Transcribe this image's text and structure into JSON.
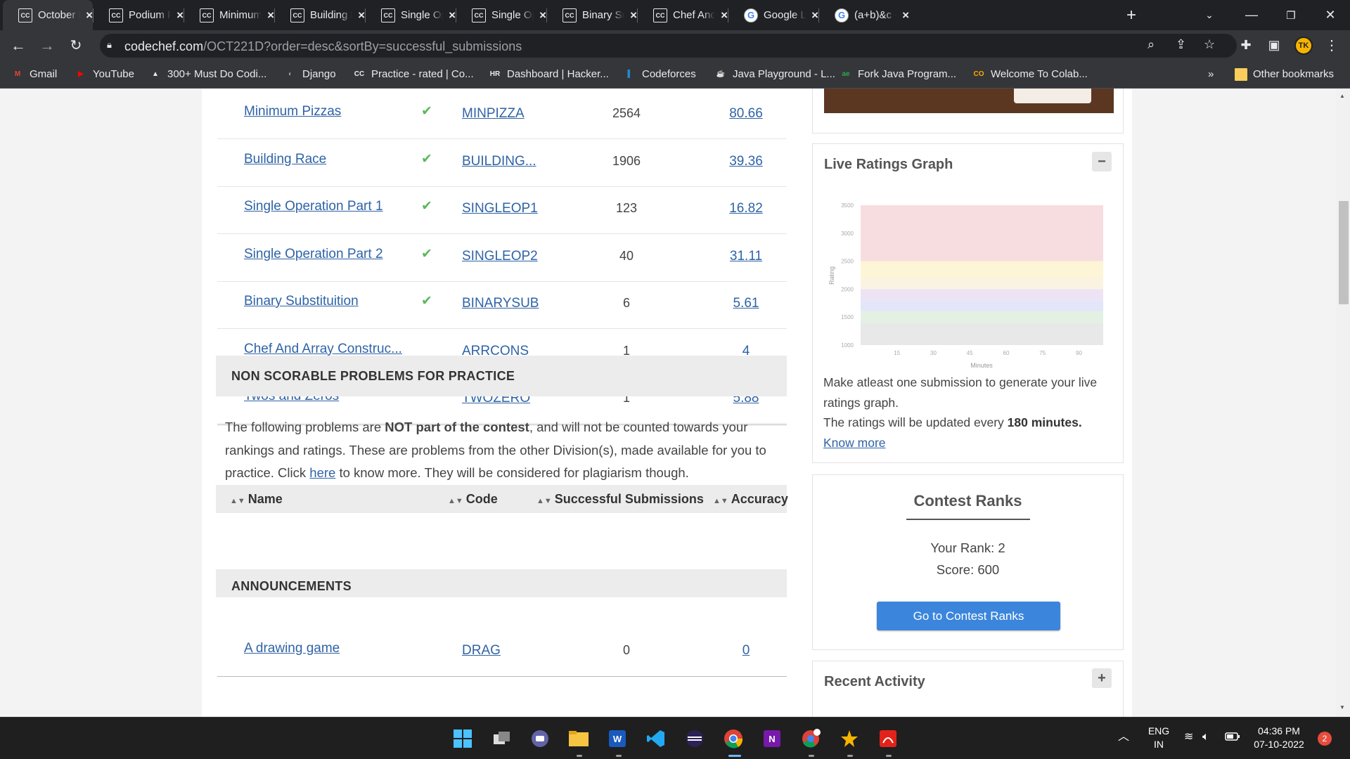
{
  "browser": {
    "tabs": [
      {
        "icon": "CC",
        "title": "October Long"
      },
      {
        "icon": "CC",
        "title": "Podium Finish"
      },
      {
        "icon": "CC",
        "title": "Minimum Pizzas"
      },
      {
        "icon": "CC",
        "title": "Building Race"
      },
      {
        "icon": "CC",
        "title": "Single Operation"
      },
      {
        "icon": "CC",
        "title": "Single Operation"
      },
      {
        "icon": "CC",
        "title": "Binary Substituition"
      },
      {
        "icon": "CC",
        "title": "Chef And Array"
      },
      {
        "icon": "G",
        "title": "Google Lens"
      },
      {
        "icon": "G",
        "title": "(a+b)&c - Google"
      }
    ],
    "new_tab_label": "+",
    "url_host": "codechef.com",
    "url_path": "/OCT221D?order=desc&sortBy=successful_submissions",
    "profile_initials": "TK",
    "bookmarks": [
      {
        "icon": "M",
        "label": "Gmail",
        "color": "#ea4335"
      },
      {
        "icon": "▶",
        "label": "YouTube",
        "color": "#ff0000"
      },
      {
        "icon": "▲",
        "label": "300+ Must Do Codi...",
        "color": "#e8eaed"
      },
      {
        "icon": "◐",
        "label": "Django",
        "color": "#9aa0a6"
      },
      {
        "icon": "CC",
        "label": "Practice - rated | Co...",
        "color": "#e8eaed"
      },
      {
        "icon": "HR",
        "label": "Dashboard | Hacker...",
        "color": "#e8eaed"
      },
      {
        "icon": "▌",
        "label": "Codeforces",
        "color": "#1f8acb"
      },
      {
        "icon": "☕",
        "label": "Java Playground - L...",
        "color": "#f89820"
      },
      {
        "icon": "ae",
        "label": "Fork Java Program...",
        "color": "#2aa84a"
      },
      {
        "icon": "CO",
        "label": "Welcome To Colab...",
        "color": "#f9ab00"
      }
    ],
    "more_bookmarks": "»",
    "other_bookmarks": "Other bookmarks"
  },
  "problems": [
    {
      "name": "Minimum Pizzas",
      "solved": true,
      "code": "MINPIZZA",
      "successful_submissions": "2564",
      "accuracy": "80.66"
    },
    {
      "name": "Building Race",
      "solved": true,
      "code": "BUILDING...",
      "successful_submissions": "1906",
      "accuracy": "39.36"
    },
    {
      "name": "Single Operation Part 1",
      "solved": true,
      "code": "SINGLEOP1",
      "successful_submissions": "123",
      "accuracy": "16.82"
    },
    {
      "name": "Single Operation Part 2",
      "solved": true,
      "code": "SINGLEOP2",
      "successful_submissions": "40",
      "accuracy": "31.11"
    },
    {
      "name": "Binary Substituition",
      "solved": true,
      "code": "BINARYSUB",
      "successful_submissions": "6",
      "accuracy": "5.61"
    },
    {
      "name": "Chef And Array Construc...",
      "solved": false,
      "code": "ARRCONS",
      "successful_submissions": "1",
      "accuracy": "4"
    },
    {
      "name": "Twos and Zeros",
      "solved": false,
      "code": "TWOZERO",
      "successful_submissions": "1",
      "accuracy": "5.88"
    }
  ],
  "non_scorable": {
    "title": "NON SCORABLE PROBLEMS FOR PRACTICE",
    "para_1": "The following problems are ",
    "para_bold": "NOT part of the contest",
    "para_2": ", and will not be counted towards your rankings and ratings. These are problems from the other Division(s), made available for you to practice. Click ",
    "para_link": "here",
    "para_3": " to know more. They will be considered for plagiarism though.",
    "headers": {
      "name": "Name",
      "code": "Code",
      "subs": "Successful Submissions",
      "acc": "Accuracy"
    },
    "rows": [
      {
        "name": "A drawing game",
        "code": "DRAG",
        "successful_submissions": "0",
        "accuracy": "0"
      }
    ]
  },
  "announcements_title": "ANNOUNCEMENTS",
  "live_graph": {
    "title": "Live Ratings Graph",
    "toggle": "−",
    "y_label": "Rating",
    "x_label": "Minutes",
    "msg": "Make atleast one submission to generate your live ratings graph.",
    "update_text": "The ratings will be updated every ",
    "update_bold": "180 minutes.",
    "know_more": "Know more"
  },
  "chart_data": {
    "type": "area",
    "title": "",
    "xlabel": "Minutes",
    "ylabel": "Rating",
    "x_ticks": [
      15,
      30,
      45,
      60,
      75,
      90
    ],
    "y_ticks": [
      1000,
      1500,
      2000,
      2500,
      3000,
      3500
    ],
    "ylim": [
      1000,
      3500
    ],
    "xlim": [
      0,
      100
    ],
    "series": [],
    "bands": [
      {
        "from": 1000,
        "to": 1400,
        "color": "#e8e8e8"
      },
      {
        "from": 1400,
        "to": 1600,
        "color": "#e2f1e2"
      },
      {
        "from": 1600,
        "to": 1800,
        "color": "#e2e6f8"
      },
      {
        "from": 1800,
        "to": 2000,
        "color": "#ece4f4"
      },
      {
        "from": 2000,
        "to": 2200,
        "color": "#fbf3e2"
      },
      {
        "from": 2200,
        "to": 2500,
        "color": "#fdf5d5"
      },
      {
        "from": 2500,
        "to": 3500,
        "color": "#f7dde0"
      }
    ]
  },
  "contest_ranks": {
    "title": "Contest Ranks",
    "rank_text": "Your Rank: 2",
    "score_text": "Score: 600",
    "button": "Go to Contest Ranks"
  },
  "recent_activity": {
    "title": "Recent Activity",
    "toggle": "+"
  },
  "system_tray": {
    "lang": "ENG",
    "region": "IN",
    "time": "04:36 PM",
    "date": "07-10-2022",
    "notifications": "2"
  }
}
